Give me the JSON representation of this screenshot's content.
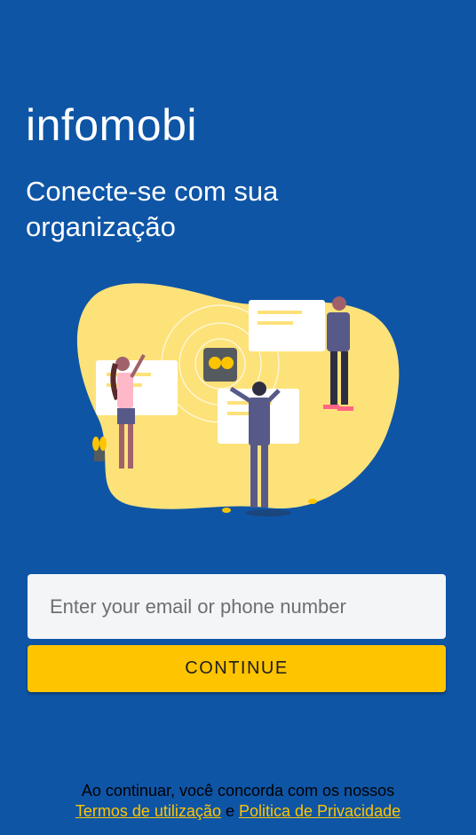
{
  "brand": {
    "name": "infomobi"
  },
  "header": {
    "tagline": "Conecte-se com sua organização"
  },
  "form": {
    "email_placeholder": "Enter your email or phone number",
    "continue_label": "CONTINUE"
  },
  "footer": {
    "consent_text": "Ao continuar, você concorda com os nossos",
    "terms_link": "Termos de utilização",
    "conjunction": "e",
    "privacy_link": "Politica de Privacidade"
  },
  "colors": {
    "background": "#0e55a6",
    "accent": "#ffc400",
    "blob": "#fde27a"
  }
}
